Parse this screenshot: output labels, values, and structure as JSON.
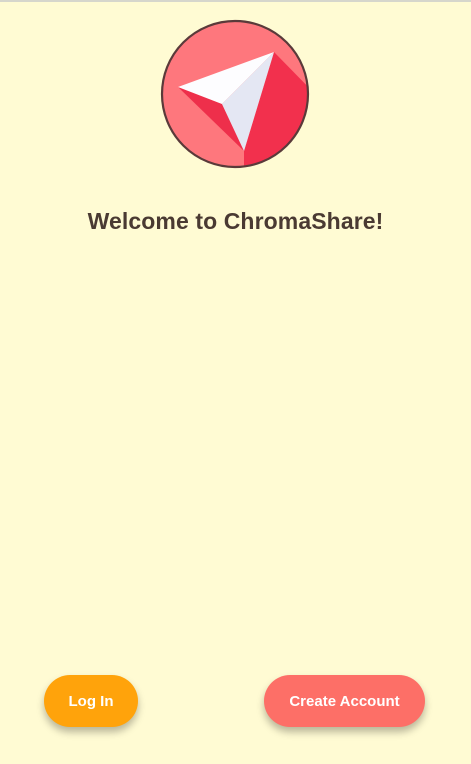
{
  "app": {
    "welcome_title": "Welcome to ChromaShare!"
  },
  "actions": {
    "login_label": "Log In",
    "create_account_label": "Create Account"
  },
  "colors": {
    "background": "#fffbd3",
    "login_button": "#ffa30b",
    "create_account_button": "#fd6f67",
    "title_text": "#4a3a32",
    "logo_circle": "#fe777d",
    "logo_plane_shadow": "#f2304d",
    "logo_plane": "#e8ebf6"
  },
  "icons": {
    "logo": "paper-plane-icon"
  }
}
